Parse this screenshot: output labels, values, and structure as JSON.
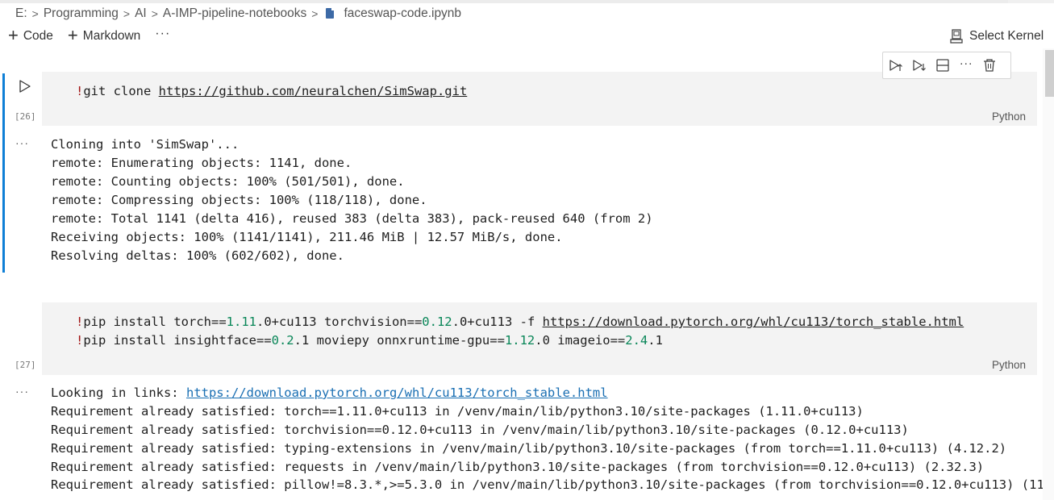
{
  "breadcrumb": {
    "items": [
      "E:",
      "Programming",
      "AI",
      "A-IMP-pipeline-notebooks"
    ],
    "file": "faceswap-code.ipynb"
  },
  "toolbar": {
    "add_code_label": "Code",
    "add_markdown_label": "Markdown",
    "more_label": "···",
    "select_kernel_label": "Select Kernel"
  },
  "cell_toolbar": {
    "icons": [
      "execute-above-icon",
      "execute-below-icon",
      "split-cell-icon",
      "more-icon",
      "delete-icon"
    ],
    "more_label": "···"
  },
  "cells": [
    {
      "exec_count": "[26]",
      "language": "Python",
      "code": [
        {
          "bang": "!",
          "cmd": "git clone ",
          "url": "https://github.com/neuralchen/SimSwap.git"
        }
      ],
      "output_more": "···",
      "output": [
        "Cloning into 'SimSwap'...",
        "remote: Enumerating objects: 1141, done.",
        "remote: Counting objects: 100% (501/501), done.",
        "remote: Compressing objects: 100% (118/118), done.",
        "remote: Total 1141 (delta 416), reused 383 (delta 383), pack-reused 640 (from 2)",
        "Receiving objects: 100% (1141/1141), 211.46 MiB | 12.57 MiB/s, done.",
        "Resolving deltas: 100% (602/602), done."
      ]
    },
    {
      "exec_count": "[27]",
      "language": "Python",
      "code_line1": {
        "bang": "!",
        "p1": "pip install torch==",
        "n1": "1.11",
        "p2": ".0+cu113 torchvision==",
        "n2": "0.12",
        "p3": ".0+cu113 -f ",
        "url": "https://download.pytorch.org/whl/cu113/torch_stable.html"
      },
      "code_line2": {
        "bang": "!",
        "p1": "pip install insightface==",
        "n1": "0.2",
        "p2": ".1 moviepy onnxruntime-gpu==",
        "n2": "1.12",
        "p3": ".0 imageio==",
        "n3": "2.4",
        "p4": ".1"
      },
      "output_more": "···",
      "output_link_prefix": "Looking in links: ",
      "output_link": "https://download.pytorch.org/whl/cu113/torch_stable.html",
      "output": [
        "Requirement already satisfied: torch==1.11.0+cu113 in /venv/main/lib/python3.10/site-packages (1.11.0+cu113)",
        "Requirement already satisfied: torchvision==0.12.0+cu113 in /venv/main/lib/python3.10/site-packages (0.12.0+cu113)",
        "Requirement already satisfied: typing-extensions in /venv/main/lib/python3.10/site-packages (from torch==1.11.0+cu113) (4.12.2)",
        "Requirement already satisfied: requests in /venv/main/lib/python3.10/site-packages (from torchvision==0.12.0+cu113) (2.32.3)",
        "Requirement already satisfied: pillow!=8.3.*,>=5.3.0 in /venv/main/lib/python3.10/site-packages (from torchvision==0.12.0+cu113) (11."
      ]
    }
  ],
  "colors": {
    "focus_bar": "#0e7fd6",
    "cell_bg": "#f3f3f3",
    "link": "#1a6fb3",
    "bang": "#a31515",
    "number": "#098658"
  }
}
